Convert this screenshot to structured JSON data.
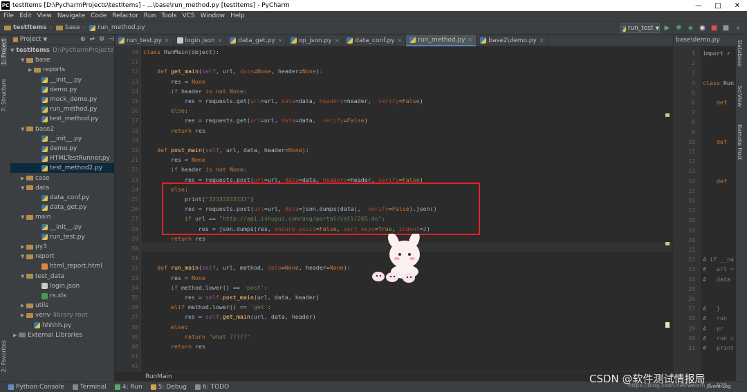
{
  "window": {
    "title": "testItems [D:\\PycharmProjects\\testItems] - ...\\base\\run_method.py [testItems] - PyCharm",
    "app_icon": "PC"
  },
  "menu": [
    "File",
    "Edit",
    "View",
    "Navigate",
    "Code",
    "Refactor",
    "Run",
    "Tools",
    "VCS",
    "Window",
    "Help"
  ],
  "breadcrumb": [
    "testItems",
    "base",
    "run_method.py"
  ],
  "run_config": "run_test",
  "left_strip": {
    "project": "1: Project",
    "structure": "7: Structure",
    "favorites": "2: Favorites"
  },
  "project_panel": {
    "header": "Project",
    "tree": [
      {
        "label": "testItems",
        "note": "D:\\PycharmProjects\\",
        "type": "folder",
        "level": 0,
        "arrow": "▼",
        "bold": true
      },
      {
        "label": "base",
        "type": "folder",
        "level": 1,
        "arrow": "▼"
      },
      {
        "label": "reports",
        "type": "folder",
        "level": 2,
        "arrow": "▶"
      },
      {
        "label": "__init__.py",
        "type": "py",
        "level": 3
      },
      {
        "label": "demo.py",
        "type": "py",
        "level": 3
      },
      {
        "label": "mock_demo.py",
        "type": "py",
        "level": 3
      },
      {
        "label": "run_method.py",
        "type": "py",
        "level": 3
      },
      {
        "label": "test_method.py",
        "type": "py",
        "level": 3
      },
      {
        "label": "base2",
        "type": "folder",
        "level": 1,
        "arrow": "▼"
      },
      {
        "label": "__init__.py",
        "type": "py",
        "level": 3
      },
      {
        "label": "demo.py",
        "type": "py",
        "level": 3
      },
      {
        "label": "HTMLTestRunner.py",
        "type": "py",
        "level": 3
      },
      {
        "label": "test_method2.py",
        "type": "py",
        "level": 3,
        "selected": true
      },
      {
        "label": "case",
        "type": "folder",
        "level": 1,
        "arrow": "▶"
      },
      {
        "label": "data",
        "type": "folder",
        "level": 1,
        "arrow": "▼"
      },
      {
        "label": "data_conf.py",
        "type": "py",
        "level": 3
      },
      {
        "label": "data_get.py",
        "type": "py",
        "level": 3
      },
      {
        "label": "main",
        "type": "folder",
        "level": 1,
        "arrow": "▼"
      },
      {
        "label": "__init__.py",
        "type": "py",
        "level": 3
      },
      {
        "label": "run_test.py",
        "type": "py",
        "level": 3
      },
      {
        "label": "py3",
        "type": "folder",
        "level": 1,
        "arrow": "▶"
      },
      {
        "label": "report",
        "type": "folder",
        "level": 1,
        "arrow": "▼"
      },
      {
        "label": "html_report.html",
        "type": "html",
        "level": 3
      },
      {
        "label": "test_data",
        "type": "folder",
        "level": 1,
        "arrow": "▼"
      },
      {
        "label": "login.json",
        "type": "json",
        "level": 3
      },
      {
        "label": "rs.xls",
        "type": "xls",
        "level": 3
      },
      {
        "label": "utils",
        "type": "folder",
        "level": 1,
        "arrow": "▶"
      },
      {
        "label": "venv",
        "note": "library root",
        "type": "folder",
        "level": 1,
        "arrow": "▶"
      },
      {
        "label": "hhhhh.py",
        "type": "py",
        "level": 2
      },
      {
        "label": "External Libraries",
        "type": "lib",
        "level": 0,
        "arrow": "▶"
      }
    ]
  },
  "tabs": [
    {
      "label": "run_test.py",
      "active": false
    },
    {
      "label": "login.json",
      "active": false
    },
    {
      "label": "data_get.py",
      "active": false
    },
    {
      "label": "op_json.py",
      "active": false
    },
    {
      "label": "data_conf.py",
      "active": false
    },
    {
      "label": "run_method.py",
      "active": true
    },
    {
      "label": "base2\\demo.py",
      "active": false
    }
  ],
  "code_lines": [
    {
      "n": "10",
      "t": "class RunMain(object):"
    },
    {
      "n": "11",
      "t": ""
    },
    {
      "n": "12",
      "t": "    def get_main(self, url, data=None, header=None):"
    },
    {
      "n": "13",
      "t": "        res = None"
    },
    {
      "n": "14",
      "t": "        if header is not None:"
    },
    {
      "n": "15",
      "t": "            res = requests.get(url=url, data=data, headers=header,  verify=False)"
    },
    {
      "n": "16",
      "t": "        else:"
    },
    {
      "n": "17",
      "t": "            res = requests.get(url=url, data=data,  verify=False)"
    },
    {
      "n": "18",
      "t": "        return res"
    },
    {
      "n": "19",
      "t": ""
    },
    {
      "n": "20",
      "t": "    def post_main(self, url, data, header=None):"
    },
    {
      "n": "21",
      "t": "        res = None"
    },
    {
      "n": "22",
      "t": "        if header is not None:"
    },
    {
      "n": "23",
      "t": "            res = requests.post(url=url, data=data, headers=header, verify=False)"
    },
    {
      "n": "24",
      "t": "        else:"
    },
    {
      "n": "25",
      "t": "            print(\"33333333333\")"
    },
    {
      "n": "26",
      "t": "            res = requests.post(url=url, data=json.dumps(data),  verify=False).json()"
    },
    {
      "n": "27",
      "t": "            if url == \"http://api.ishugui.com/asg/portal/call/265.do\":"
    },
    {
      "n": "28",
      "t": "                res = json.dumps(res, ensure_ascii=False, sort_keys=True, indent=2)"
    },
    {
      "n": "29",
      "t": "        return res"
    },
    {
      "n": "30",
      "t": ""
    },
    {
      "n": "31",
      "t": ""
    },
    {
      "n": "32",
      "t": "    def run_main(self, url, method, data=None, header=None):"
    },
    {
      "n": "33",
      "t": "        res = None"
    },
    {
      "n": "34",
      "t": "        if method.lower() == 'post':"
    },
    {
      "n": "35",
      "t": "            res = self.post_main(url, data, header)"
    },
    {
      "n": "36",
      "t": "        elif method.lower() == 'get':"
    },
    {
      "n": "37",
      "t": "            res = self.get_main(url, data, header)"
    },
    {
      "n": "38",
      "t": "        else:"
    },
    {
      "n": "39",
      "t": "            return \"what ?????\""
    },
    {
      "n": "40",
      "t": "        return res"
    },
    {
      "n": "41",
      "t": ""
    },
    {
      "n": "42",
      "t": ""
    }
  ],
  "editor_breadcrumb": "RunMain",
  "right_pane": {
    "tab": "base\\demo.py",
    "lines": [
      {
        "n": "1",
        "t": "import r"
      },
      {
        "n": "2",
        "t": ""
      },
      {
        "n": "3",
        "t": ""
      },
      {
        "n": "4",
        "t": "class Run"
      },
      {
        "n": "5",
        "t": ""
      },
      {
        "n": "6",
        "t": "    def"
      },
      {
        "n": "7",
        "t": ""
      },
      {
        "n": "8",
        "t": ""
      },
      {
        "n": "9",
        "t": ""
      },
      {
        "n": "10",
        "t": "    def"
      },
      {
        "n": "11",
        "t": ""
      },
      {
        "n": "12",
        "t": ""
      },
      {
        "n": "13",
        "t": ""
      },
      {
        "n": "14",
        "t": "    def"
      },
      {
        "n": "15",
        "t": ""
      },
      {
        "n": "16",
        "t": ""
      },
      {
        "n": "17",
        "t": ""
      },
      {
        "n": "18",
        "t": ""
      },
      {
        "n": "19",
        "t": ""
      },
      {
        "n": "20",
        "t": ""
      },
      {
        "n": "21",
        "t": ""
      },
      {
        "n": "22",
        "t": "# if __na"
      },
      {
        "n": "23",
        "t": "#   url ="
      },
      {
        "n": "24",
        "t": "#   data"
      },
      {
        "n": "25",
        "t": ""
      },
      {
        "n": "26",
        "t": ""
      },
      {
        "n": "27",
        "t": "#   }"
      },
      {
        "n": "28",
        "t": "#   run"
      },
      {
        "n": "29",
        "t": "#   pr"
      },
      {
        "n": "30",
        "t": "#   run ="
      },
      {
        "n": "31",
        "t": "#   print"
      }
    ]
  },
  "right_strip": [
    "Database",
    "SciView",
    "Remote Host"
  ],
  "bottom_tabs": [
    {
      "label": "Python Console",
      "color": "#5b8fbf"
    },
    {
      "label": "Terminal",
      "color": "#888888"
    },
    {
      "label": "4: Run",
      "color": "#59a869"
    },
    {
      "label": "5: Debug",
      "color": "#d0a548"
    },
    {
      "label": "6: TODO",
      "color": "#8c8c8c"
    }
  ],
  "status_right": "https://blog.csdn.net/weixin_4...925",
  "event_log": "Event Log",
  "watermark": "CSDN @软件测试情报局",
  "colors": {
    "accent": "#4a88c7",
    "highlight_box": "#e0232c",
    "keyword": "#cc7832",
    "string": "#6a8759",
    "param": "#aa4926",
    "func": "#ffc66d",
    "number": "#6897bb"
  }
}
